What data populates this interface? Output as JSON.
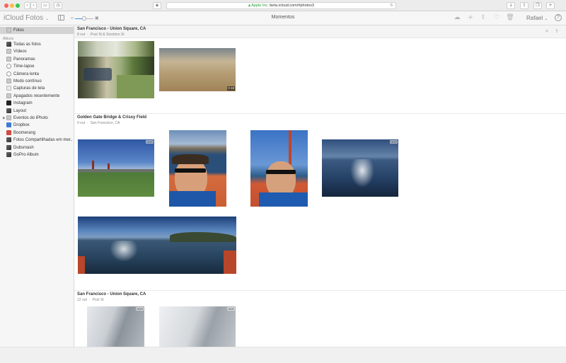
{
  "browser": {
    "address_secure": "Apple Inc.",
    "address_url": "beta.icloud.com/#photos3"
  },
  "app": {
    "brand_icloud": "iCloud",
    "brand_app": "Fotos",
    "view_title": "Momentos",
    "user_name": "Rafael",
    "help": "?"
  },
  "zoom": {
    "level": 0.5
  },
  "sidebar": {
    "top_item": {
      "label": "Fotos",
      "icon": "photos-icon"
    },
    "albums_header": "Álbuns",
    "items": [
      {
        "label": "Todas as fotos",
        "icon": "all-photos-icon"
      },
      {
        "label": "Vídeos",
        "icon": "videos-icon"
      },
      {
        "label": "Panoramas",
        "icon": "panoramas-icon"
      },
      {
        "label": "Time-lapse",
        "icon": "time-lapse-icon"
      },
      {
        "label": "Câmera lenta",
        "icon": "slow-motion-icon"
      },
      {
        "label": "Modo contínuo",
        "icon": "burst-icon"
      },
      {
        "label": "Capturas de tela",
        "icon": "screenshots-icon"
      },
      {
        "label": "Apagados recentemente",
        "icon": "trash-icon"
      },
      {
        "label": "Instagram",
        "icon": "album-icon"
      },
      {
        "label": "Layout",
        "icon": "album-icon"
      },
      {
        "label": "Eventos do iPhoto",
        "icon": "folder-icon"
      },
      {
        "label": "Dropbox",
        "icon": "album-icon"
      },
      {
        "label": "Boomerang",
        "icon": "album-icon"
      },
      {
        "label": "Fotos Compartilhadas em mer...",
        "icon": "album-icon"
      },
      {
        "label": "Dubsmash",
        "icon": "album-icon"
      },
      {
        "label": "GoPro Album",
        "icon": "album-icon"
      }
    ]
  },
  "moments": [
    {
      "title": "San Francisco - Union Square, CA",
      "date": "8 out",
      "place": "Post St & Stockton St",
      "photos": [
        {
          "kind": "bar",
          "badge": ""
        },
        {
          "kind": "sand",
          "duration": "0:18"
        }
      ]
    },
    {
      "title": "Golden Gate Bridge & Crissy Field",
      "date": "9 out",
      "place": "San Francisco, CA",
      "photos": [
        {
          "kind": "bridge-field",
          "badge": "HDR"
        },
        {
          "kind": "selfie-1",
          "badge": ""
        },
        {
          "kind": "selfie-2",
          "badge": ""
        },
        {
          "kind": "bay",
          "badge": "HDR"
        },
        {
          "kind": "panorama",
          "badge": ""
        }
      ]
    },
    {
      "title": "San Francisco - Union Square, CA",
      "date": "12 out",
      "place": "Post St",
      "photos": [
        {
          "kind": "building-1",
          "badge": "HDR"
        },
        {
          "kind": "building-2",
          "badge": "HDR"
        }
      ]
    }
  ]
}
